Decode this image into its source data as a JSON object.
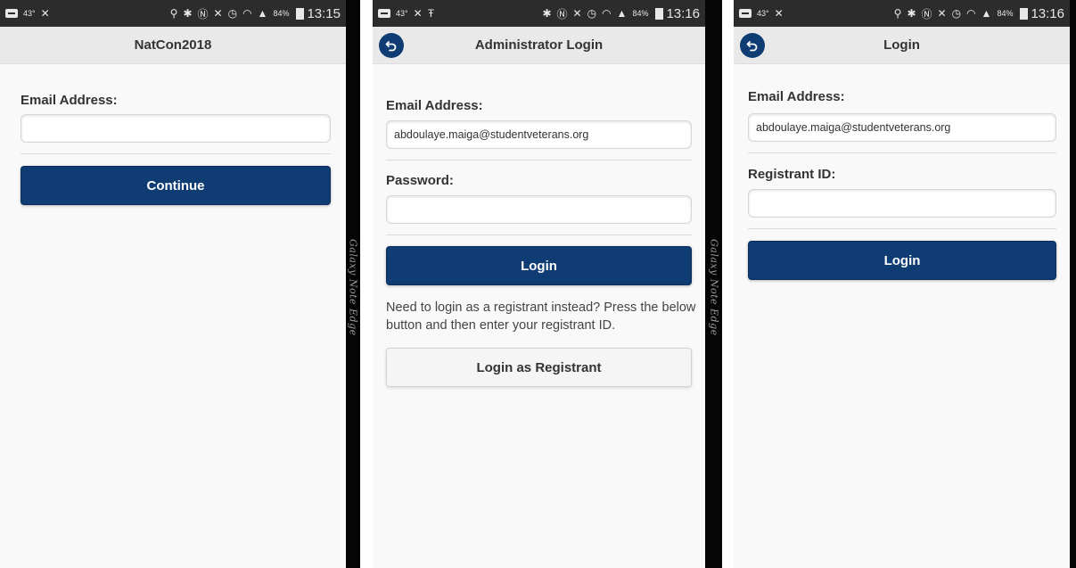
{
  "status_bars": [
    {
      "temp": "43°",
      "battery": "84%",
      "time": "13:15"
    },
    {
      "temp": "43°",
      "battery": "84%",
      "time": "13:16"
    },
    {
      "temp": "43°",
      "battery": "84%",
      "time": "13:16"
    }
  ],
  "device_edge_label": "Galaxy Note Edge",
  "screen1": {
    "title": "NatCon2018",
    "email_label": "Email Address:",
    "email_value": "",
    "continue_label": "Continue"
  },
  "screen2": {
    "title": "Administrator Login",
    "email_label": "Email Address:",
    "email_value": "abdoulaye.maiga@studentveterans.org",
    "password_label": "Password:",
    "password_value": "",
    "login_label": "Login",
    "help_text": "Need to login as a registrant instead? Press the below button and then enter your registrant ID.",
    "registrant_button_label": "Login as Registrant"
  },
  "screen3": {
    "title": "Login",
    "email_label": "Email Address:",
    "email_value": "abdoulaye.maiga@studentveterans.org",
    "registrant_id_label": "Registrant ID:",
    "registrant_id_value": "",
    "login_label": "Login"
  },
  "colors": {
    "primary": "#0f3d73",
    "header_bg": "#e9e9e9",
    "statusbar_bg": "#2c2c2c"
  }
}
